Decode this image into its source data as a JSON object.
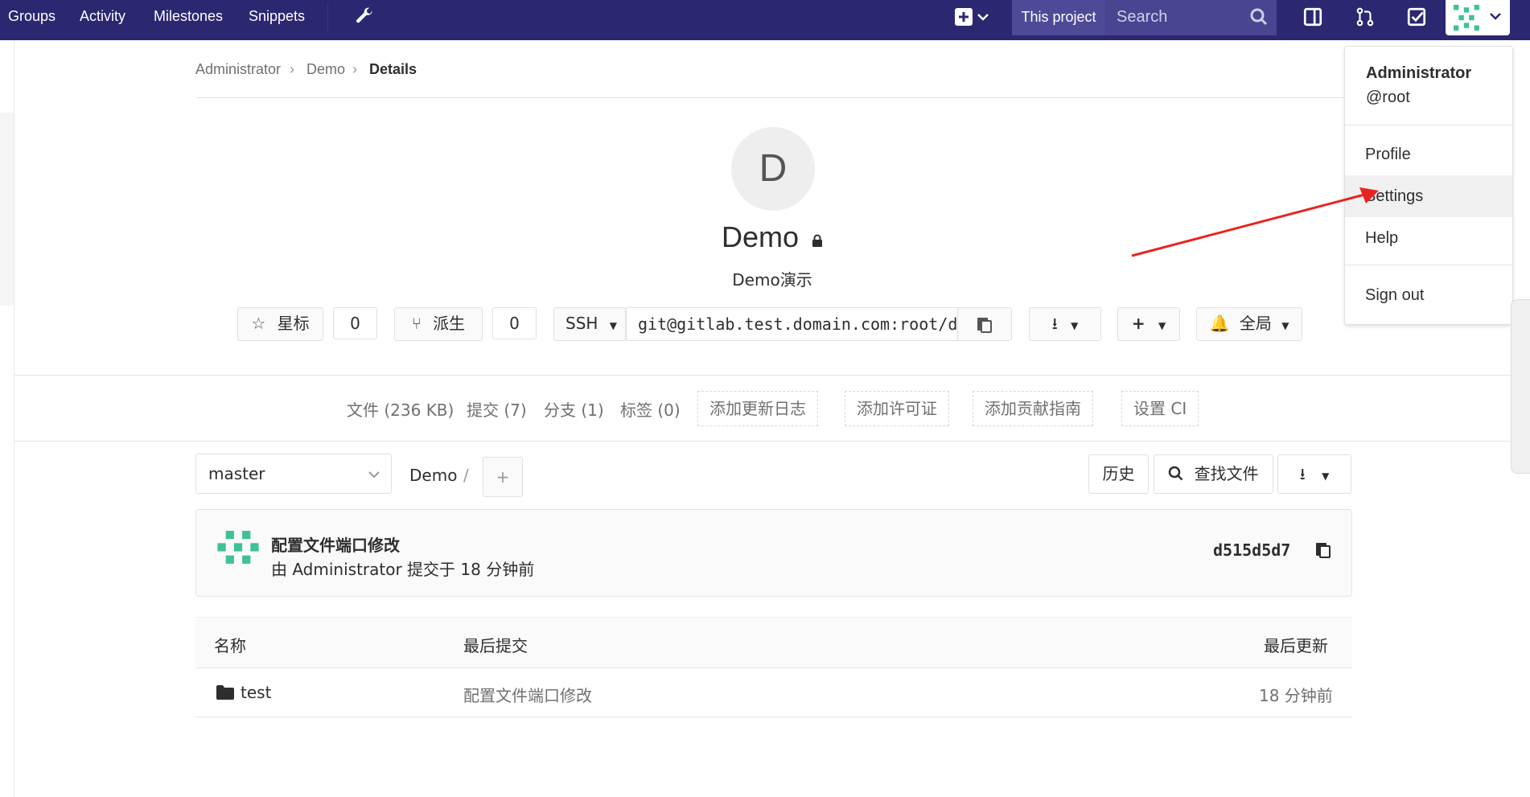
{
  "nav": {
    "links": [
      "Groups",
      "Activity",
      "Milestones",
      "Snippets"
    ],
    "scope_label": "This project",
    "search_placeholder": "Search"
  },
  "breadcrumb": [
    "Administrator",
    "Demo",
    "Details"
  ],
  "project": {
    "avatar_letter": "D",
    "name": "Demo",
    "description": "Demo演示"
  },
  "actions": {
    "star_label": "星标",
    "star_count": "0",
    "fork_label": "派生",
    "fork_count": "0",
    "protocol": "SSH",
    "clone_url": "git@gitlab.test.domain.com:root/demo.git",
    "notification_label": "全局"
  },
  "stats": {
    "files": "文件 (236 KB)",
    "commits": "提交 (7)",
    "branches": "分支 (1)",
    "tags": "标签 (0)",
    "add_changelog": "添加更新日志",
    "add_license": "添加许可证",
    "add_contributing": "添加贡献指南",
    "setup_ci": "设置 CI"
  },
  "tree": {
    "branch": "master",
    "path_root": "Demo",
    "path_sep": "/",
    "history_label": "历史",
    "find_file_label": "查找文件"
  },
  "last_commit": {
    "title": "配置文件端口修改",
    "meta": "由 Administrator 提交于 18 分钟前",
    "sha": "d515d5d7"
  },
  "table": {
    "headers": [
      "名称",
      "最后提交",
      "最后更新"
    ],
    "rows": [
      {
        "name": "test",
        "commit": "配置文件端口修改",
        "updated": "18 分钟前"
      }
    ]
  },
  "user_menu": {
    "name": "Administrator",
    "handle": "@root",
    "items": [
      "Profile",
      "Settings",
      "Help",
      "Sign out"
    ]
  },
  "colors": {
    "nav_bg": "#2c2771",
    "arrow": "#e8241f"
  }
}
